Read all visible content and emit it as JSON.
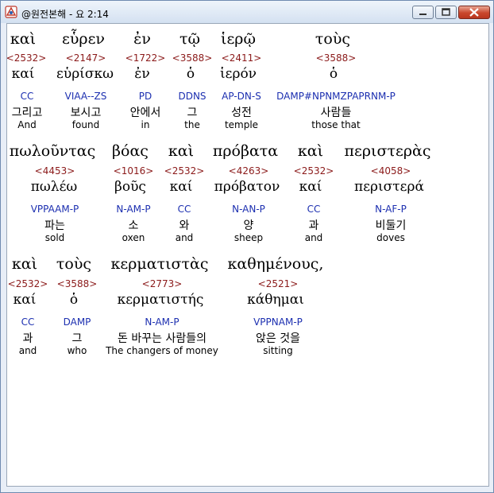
{
  "window": {
    "title": "@원전본해 - 요 2:14",
    "controls": {
      "minimize": "minimize",
      "maximize": "maximize",
      "close": "close"
    }
  },
  "colors": {
    "strong": "#8b1a1a",
    "parse": "#1c2fb0",
    "text": "#000000"
  },
  "rows": [
    {
      "words": [
        {
          "greek": "καὶ",
          "strong": "<2532>",
          "lemma": "καί",
          "parse": "CC",
          "korean": "그리고",
          "english": "And"
        },
        {
          "greek": "εὗρεν",
          "strong": "<2147>",
          "lemma": "εὑρίσκω",
          "parse": "VIAA--ZS",
          "korean": "보시고",
          "english": "found"
        },
        {
          "greek": "ἐν",
          "strong": "<1722>",
          "lemma": "ἐν",
          "parse": "PD",
          "korean": "안에서",
          "english": "in"
        },
        {
          "greek": "τῷ",
          "strong": "<3588>",
          "lemma": "ὁ",
          "parse": "DDNS",
          "korean": "그",
          "english": "the"
        },
        {
          "greek": "ἱερῷ",
          "strong": "<2411>",
          "lemma": "ἱερόν",
          "parse": "AP-DN-S",
          "korean": "성전",
          "english": "temple"
        },
        {
          "greek": "τοὺς",
          "strong": "<3588>",
          "lemma": "ὁ",
          "parse": "DAMP#NPNMZPAPRNM-P",
          "korean": "사람들",
          "english": "those that"
        }
      ]
    },
    {
      "words": [
        {
          "greek": "πωλοῦντας",
          "strong": "<4453>",
          "lemma": "πωλέω",
          "parse": "VPPAAM-P",
          "korean": "파는",
          "english": "sold"
        },
        {
          "greek": "βόας",
          "strong": "<1016>",
          "lemma": "βοῦς",
          "parse": "N-AM-P",
          "korean": "소",
          "english": "oxen"
        },
        {
          "greek": "καὶ",
          "strong": "<2532>",
          "lemma": "καί",
          "parse": "CC",
          "korean": "와",
          "english": "and"
        },
        {
          "greek": "πρόβατα",
          "strong": "<4263>",
          "lemma": "πρόβατον",
          "parse": "N-AN-P",
          "korean": "양",
          "english": "sheep"
        },
        {
          "greek": "καὶ",
          "strong": "<2532>",
          "lemma": "καί",
          "parse": "CC",
          "korean": "과",
          "english": "and"
        },
        {
          "greek": "περιστερὰς",
          "strong": "<4058>",
          "lemma": "περιστερά",
          "parse": "N-AF-P",
          "korean": "비둘기",
          "english": "doves"
        }
      ]
    },
    {
      "words": [
        {
          "greek": "καὶ",
          "strong": "<2532>",
          "lemma": "καί",
          "parse": "CC",
          "korean": "과",
          "english": "and"
        },
        {
          "greek": "τοὺς",
          "strong": "<3588>",
          "lemma": "ὁ",
          "parse": "DAMP",
          "korean": "그",
          "english": "who"
        },
        {
          "greek": "κερματιστὰς",
          "strong": "<2773>",
          "lemma": "κερματιστής",
          "parse": "N-AM-P",
          "korean": "돈 바꾸는 사람들의",
          "english": "The changers of money"
        },
        {
          "greek": "καθημένους,",
          "strong": "<2521>",
          "lemma": "κάθημαι",
          "parse": "VPPNAM-P",
          "korean": "앉은 것을",
          "english": "sitting"
        }
      ]
    }
  ]
}
